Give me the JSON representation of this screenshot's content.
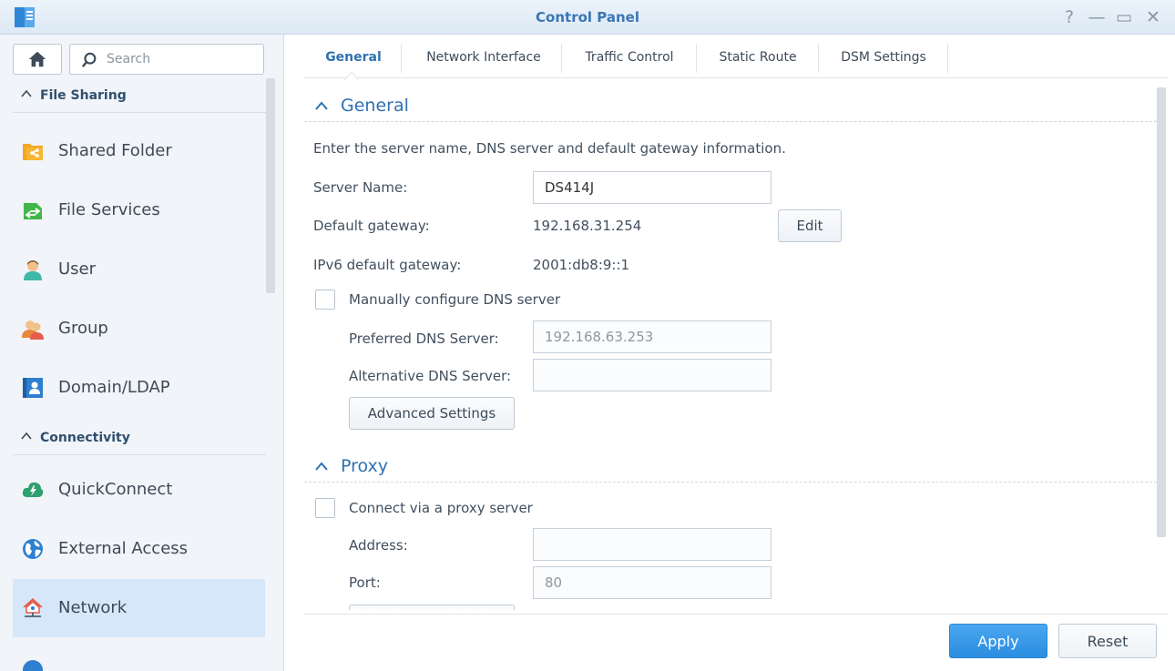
{
  "window": {
    "title": "Control Panel",
    "controls": [
      "help-icon",
      "minimize-icon",
      "maximize-icon",
      "close-icon"
    ],
    "help_glyph": "?",
    "minimize_glyph": "—",
    "maximize_glyph": "▭",
    "close_glyph": "✕"
  },
  "sidebar": {
    "search_placeholder": "Search",
    "sections": [
      {
        "label": "File Sharing",
        "expanded": true
      },
      {
        "label": "Connectivity",
        "expanded": true
      }
    ],
    "items": [
      {
        "label": "Shared Folder",
        "icon": "shared-folder-icon",
        "color": "#f5a623"
      },
      {
        "label": "File Services",
        "icon": "file-services-icon",
        "color": "#43b649"
      },
      {
        "label": "User",
        "icon": "user-icon",
        "color": "#3fb8a9"
      },
      {
        "label": "Group",
        "icon": "group-icon",
        "color": "#e8863b"
      },
      {
        "label": "Domain/LDAP",
        "icon": "domain-ldap-icon",
        "color": "#2f7fd0"
      },
      {
        "label": "QuickConnect",
        "icon": "quickconnect-icon",
        "color": "#2fa06f"
      },
      {
        "label": "External Access",
        "icon": "external-access-icon",
        "color": "#2f7fd0"
      },
      {
        "label": "Network",
        "icon": "network-icon",
        "color": "#e55b4c",
        "active": true
      }
    ]
  },
  "tabs": [
    {
      "label": "General",
      "active": true
    },
    {
      "label": "Network Interface"
    },
    {
      "label": "Traffic Control"
    },
    {
      "label": "Static Route"
    },
    {
      "label": "DSM Settings"
    }
  ],
  "general": {
    "title": "General",
    "description": "Enter the server name, DNS server and default gateway information.",
    "server_name_label": "Server Name:",
    "server_name_value": "DS414J",
    "default_gateway_label": "Default gateway:",
    "default_gateway_value": "192.168.31.254",
    "edit_label": "Edit",
    "ipv6_gateway_label": "IPv6 default gateway:",
    "ipv6_gateway_value": "2001:db8:9::1",
    "manual_dns_label": "Manually configure DNS server",
    "manual_dns_checked": false,
    "preferred_dns_label": "Preferred DNS Server:",
    "preferred_dns_value": "192.168.63.253",
    "alternative_dns_label": "Alternative DNS Server:",
    "alternative_dns_value": "",
    "advanced_settings_label": "Advanced Settings"
  },
  "proxy": {
    "title": "Proxy",
    "connect_label": "Connect via a proxy server",
    "connect_checked": false,
    "address_label": "Address:",
    "address_value": "",
    "port_label": "Port:",
    "port_value": "80"
  },
  "footer": {
    "apply_label": "Apply",
    "reset_label": "Reset"
  },
  "colors": {
    "accent": "#2f71b3",
    "apply_button": "#2b8de0",
    "active_nav": "#d5e7f8"
  }
}
